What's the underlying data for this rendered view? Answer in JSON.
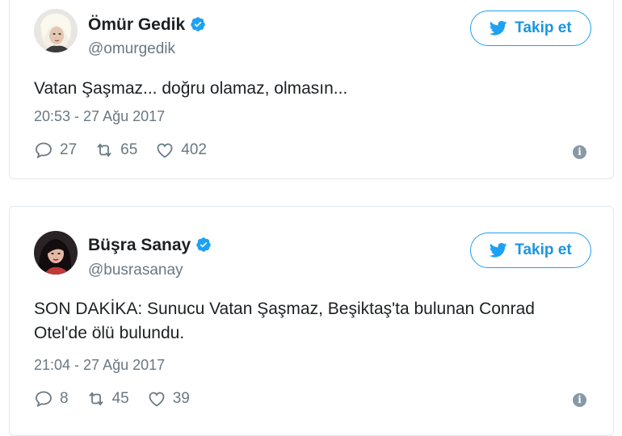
{
  "tweets": [
    {
      "name": "Ömür Gedik",
      "handle": "@omurgedik",
      "follow_label": "Takip et",
      "text": "Vatan Şaşmaz... doğru olamaz, olmasın...",
      "timestamp": "20:53 - 27 Ağu 2017",
      "replies": "27",
      "retweets": "65",
      "likes": "402",
      "icons": {
        "verified": "verified-badge-icon",
        "reply": "reply-icon",
        "retweet": "retweet-icon",
        "like": "heart-icon",
        "info": "info-icon",
        "follow": "twitter-bird-icon"
      }
    },
    {
      "name": "Büşra Sanay",
      "handle": "@busrasanay",
      "follow_label": "Takip et",
      "text": "SON DAKİKA: Sunucu Vatan Şaşmaz, Beşiktaş'ta bulunan Conrad Otel'de ölü bulundu.",
      "timestamp": "21:04 - 27 Ağu 2017",
      "replies": "8",
      "retweets": "45",
      "likes": "39",
      "icons": {
        "verified": "verified-badge-icon",
        "reply": "reply-icon",
        "retweet": "retweet-icon",
        "like": "heart-icon",
        "info": "info-icon",
        "follow": "twitter-bird-icon"
      }
    }
  ],
  "colors": {
    "accent": "#1da1f2",
    "follow_text": "#1b95e0",
    "muted": "#697882",
    "border": "#e1e8ed"
  }
}
